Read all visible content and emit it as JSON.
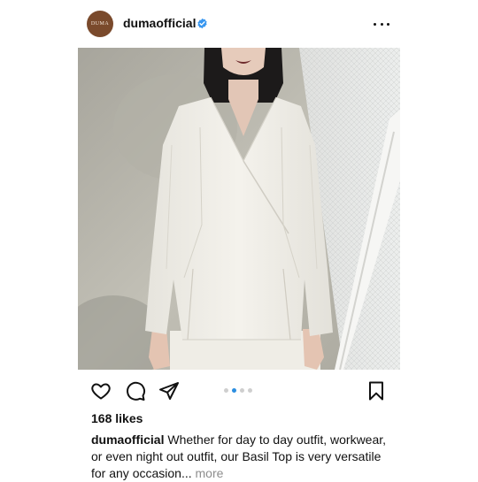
{
  "post": {
    "avatar_text": "DUMA",
    "username": "dumaofficial",
    "verified": true,
    "likes": "168 likes",
    "caption_user": "dumaofficial",
    "caption_text": "Whether for day to day outfit, workwear, or even night out outfit, our Basil Top is very versatile for any occasion",
    "caption_ellipsis": "...",
    "caption_more": "more",
    "carousel": {
      "count": 4,
      "active_index": 1
    }
  },
  "icons": {
    "header_menu": "more-horizontal-icon",
    "actions": [
      "heart-icon",
      "comment-icon",
      "share-icon",
      "bookmark-icon"
    ],
    "verified": "verified-badge-icon"
  },
  "colors": {
    "verified_blue": "#3897f0",
    "active_dot": "#2b8ee0",
    "inactive_dot": "#cfcfcf",
    "avatar_bg": "#7a4a2c",
    "muted_text": "#8e8e8e"
  }
}
